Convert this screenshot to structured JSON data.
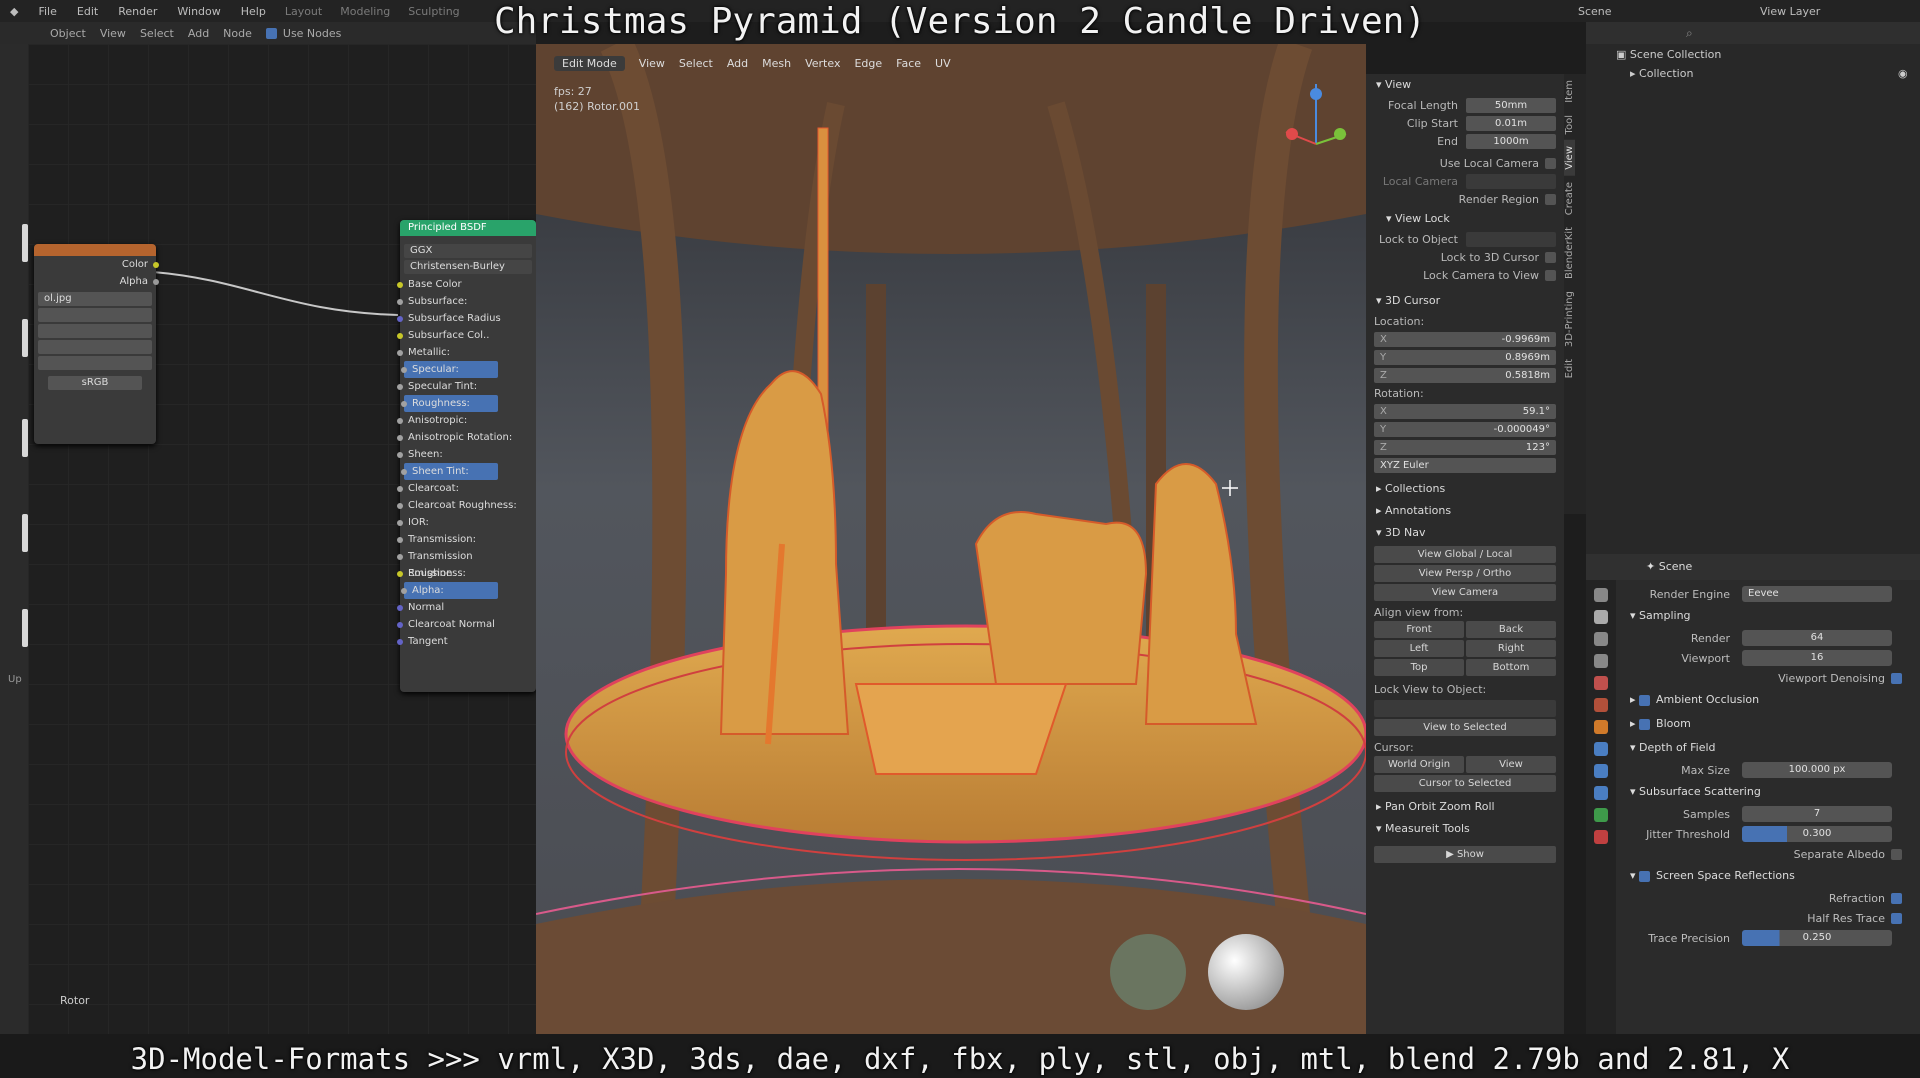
{
  "video_title": "Christmas Pyramid (Version 2 Candle Driven)",
  "video_caption": "3D-Model-Formats >>> vrml, X3D, 3ds, dae, dxf, fbx, ply, stl, obj, mtl, blend 2.79b and 2.81, X",
  "menu": [
    "File",
    "Edit",
    "Render",
    "Window",
    "Help"
  ],
  "workspace_tabs": [
    "Layout",
    "Modeling",
    "Sculpting"
  ],
  "scene_label": "Scene",
  "view_layer_label": "View Layer",
  "node_editor": {
    "header": [
      "Object",
      "View",
      "Select",
      "Add",
      "Node",
      "Use Nodes"
    ],
    "image_node": {
      "outputs": [
        "Color",
        "Alpha"
      ],
      "file": "ol.jpg",
      "colorspace": "sRGB"
    },
    "bsdf": {
      "title": "Principled BSDF",
      "distribution": "GGX",
      "subsurface_method": "Christensen-Burley",
      "inputs": [
        "Base Color",
        "Subsurface:",
        "Subsurface Radius",
        "Subsurface Col..",
        "Metallic:",
        "Specular:",
        "Specular Tint:",
        "Roughness:",
        "Anisotropic:",
        "Anisotropic Rotation:",
        "Sheen:",
        "Sheen Tint:",
        "Clearcoat:",
        "Clearcoat Roughness:",
        "IOR:",
        "Transmission:",
        "Transmission Roughness:",
        "Emission",
        "Alpha:",
        "Normal",
        "Clearcoat Normal",
        "Tangent"
      ],
      "highlighted": [
        "Specular:",
        "Roughness:",
        "Sheen Tint:",
        "Alpha:"
      ]
    },
    "rotor_label": "Rotor",
    "up_label": "Up"
  },
  "viewport": {
    "mode": "Edit Mode",
    "menus": [
      "View",
      "Select",
      "Add",
      "Mesh",
      "Vertex",
      "Edge",
      "Face",
      "UV"
    ],
    "fps": "fps: 27",
    "object_label": "(162) Rotor.001"
  },
  "npanel": {
    "tabs": [
      "Item",
      "Tool",
      "View",
      "Create",
      "BlenderKit",
      "3D-Printing",
      "Edit"
    ],
    "view_section": "View",
    "focal_length": {
      "label": "Focal Length",
      "value": "50mm"
    },
    "clip_start": {
      "label": "Clip Start",
      "value": "0.01m"
    },
    "clip_end": {
      "label": "End",
      "value": "1000m"
    },
    "use_local_camera": "Use Local Camera",
    "local_camera": "Local Camera",
    "render_region": "Render Region",
    "view_lock": "View Lock",
    "lock_to_object": "Lock to Object",
    "lock_to_cursor": "Lock to 3D Cursor",
    "lock_camera": "Lock Camera to View",
    "cursor_section": "3D Cursor",
    "location_label": "Location:",
    "loc": [
      {
        "axis": "X",
        "value": "-0.9969m"
      },
      {
        "axis": "Y",
        "value": "0.8969m"
      },
      {
        "axis": "Z",
        "value": "0.5818m"
      }
    ],
    "rotation_label": "Rotation:",
    "rot": [
      {
        "axis": "X",
        "value": "59.1°"
      },
      {
        "axis": "Y",
        "value": "-0.000049°"
      },
      {
        "axis": "Z",
        "value": "123°"
      }
    ],
    "euler": "XYZ Euler",
    "collections": "Collections",
    "annotations": "Annotations",
    "nav3d": "3D Nav",
    "view_global_local": "View Global / Local",
    "view_persp_ortho": "View Persp / Ortho",
    "view_camera": "View Camera",
    "align_view": "Align view from:",
    "align": [
      "Front",
      "Back",
      "Left",
      "Right",
      "Top",
      "Bottom"
    ],
    "lock_view": "Lock View to Object:",
    "view_selected": "View to Selected",
    "cursor": "Cursor:",
    "world_origin": "World Origin",
    "view_btn": "View",
    "cursor_selected": "Cursor to Selected",
    "pan_orbit": "Pan Orbit Zoom Roll",
    "measureit": "Measureit Tools",
    "show": "Show"
  },
  "outliner": {
    "root": "Scene Collection",
    "collection": "Collection"
  },
  "properties": {
    "scene": "Scene",
    "render_engine_label": "Render Engine",
    "render_engine": "Eevee",
    "sampling": "Sampling",
    "render_label": "Render",
    "render_samples": "64",
    "viewport_label": "Viewport",
    "viewport_samples": "16",
    "denoise": "Viewport Denoising",
    "ao": "Ambient Occlusion",
    "bloom": "Bloom",
    "dof": "Depth of Field",
    "max_size_label": "Max Size",
    "max_size": "100.000 px",
    "sss": "Subsurface Scattering",
    "samples_label": "Samples",
    "samples": "7",
    "jitter_label": "Jitter Threshold",
    "jitter": "0.300",
    "separate_albedo": "Separate Albedo",
    "ssr": "Screen Space Reflections",
    "refraction": "Refraction",
    "half_res": "Half Res Trace",
    "trace_label": "Trace Precision",
    "trace": "0.250"
  }
}
